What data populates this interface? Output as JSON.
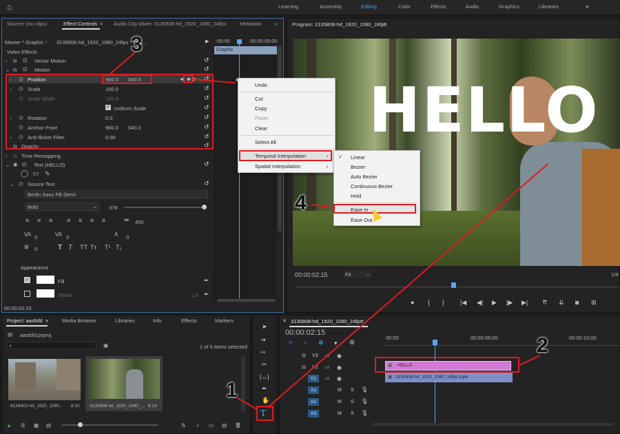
{
  "workspaces": [
    "Learning",
    "Assembly",
    "Editing",
    "Color",
    "Effects",
    "Audio",
    "Graphics",
    "Libraries"
  ],
  "source_tabs": {
    "source": "Source: (no clips)",
    "effect_controls": "Effect Controls",
    "audio_mixer": "Audio Clip Mixer: 3135808-hd_1920_1080_24fps",
    "metadata": "Metadata"
  },
  "effect_controls": {
    "master_label": "Master * Graphic",
    "sequence_label": "3135808-hd_1920_1080_24fps * Gra...",
    "time_start": ":00:00",
    "time_end": "00:00:05:00",
    "graphic_bar": "Graphic",
    "section_video_effects": "Video Effects",
    "vector_motion": "Vector Motion",
    "motion": "Motion",
    "position_label": "Position",
    "position_x": "960.0",
    "position_y": "540.0",
    "scale_label": "Scale",
    "scale_value": "100.0",
    "scale_width_label": "Scale Width",
    "scale_width_value": "100.0",
    "uniform_scale": "Uniform Scale",
    "rotation_label": "Rotation",
    "rotation_value": "0.0",
    "anchor_label": "Anchor Point",
    "anchor_x": "960.0",
    "anchor_y": "540.0",
    "antiflicker_label": "Anti-flicker Filter",
    "antiflicker_value": "0.00",
    "opacity_label": "Opacity",
    "time_remap_label": "Time Remapping",
    "text_layer": "Text (HELLO)",
    "source_text": "Source Text",
    "font_name": "Berlin Sans FB Demi",
    "font_style": "Bold",
    "font_size": "378",
    "tracking": "400",
    "kerning": "0",
    "leading": "0",
    "baseline": "0",
    "tsume": "0",
    "appearance": "Appearance",
    "fill": "Fill",
    "stroke": "Stroke",
    "stroke_width": "1.0",
    "current_time": "00:00:02:15"
  },
  "context_menu": {
    "items": [
      "Undo",
      "Cut",
      "Copy",
      "Paste",
      "Clear",
      "Select All",
      "Temporal Interpolation",
      "Spatial Interpolation"
    ],
    "submenu": [
      "Linear",
      "Bezier",
      "Auto Bezier",
      "Continuous Bezier",
      "Hold",
      "Ease In",
      "Ease Out"
    ]
  },
  "program": {
    "title": "Program: 3135808-hd_1920_1080_24fps",
    "overlay_text": "HELLO",
    "timecode": "00:00:02:15",
    "fit": "Fit",
    "fraction": "1/4"
  },
  "project": {
    "tabs": [
      "Project: aasfsfd",
      "Media Browser",
      "Libraries",
      "Info",
      "Effects",
      "Markers"
    ],
    "file": "aasfsfd.prproj",
    "items_selected": "1 of 5 items selected",
    "clip1_name": "8126402-hd_1920_1080...",
    "clip1_dur": "8:10",
    "clip2_name": "3135808-hd_1920_1080_...",
    "clip2_dur": "6:14"
  },
  "timeline": {
    "title": "3135808-hd_1920_1080_24fps",
    "timecode": "00:00:02:15",
    "ruler": [
      "00:00",
      "00:00:05:00",
      "00:00:10:00"
    ],
    "video_tracks": [
      "V3",
      "V2",
      "V1"
    ],
    "audio_tracks": [
      "A1",
      "A2",
      "A3"
    ],
    "clip_hello": "HELLO",
    "clip_video": "3135808-hd_1920_1080_24fps.mp4"
  },
  "annotations": {
    "n1": "1",
    "n2": "2",
    "n3": "3",
    "n4": "4"
  },
  "colors": {
    "accent": "#4da2ff",
    "annotation_red": "#e01b22",
    "graphic_clip": "#d37ad6",
    "video_clip": "#7f8fc6",
    "menu_bg": "#f2f2f2"
  }
}
